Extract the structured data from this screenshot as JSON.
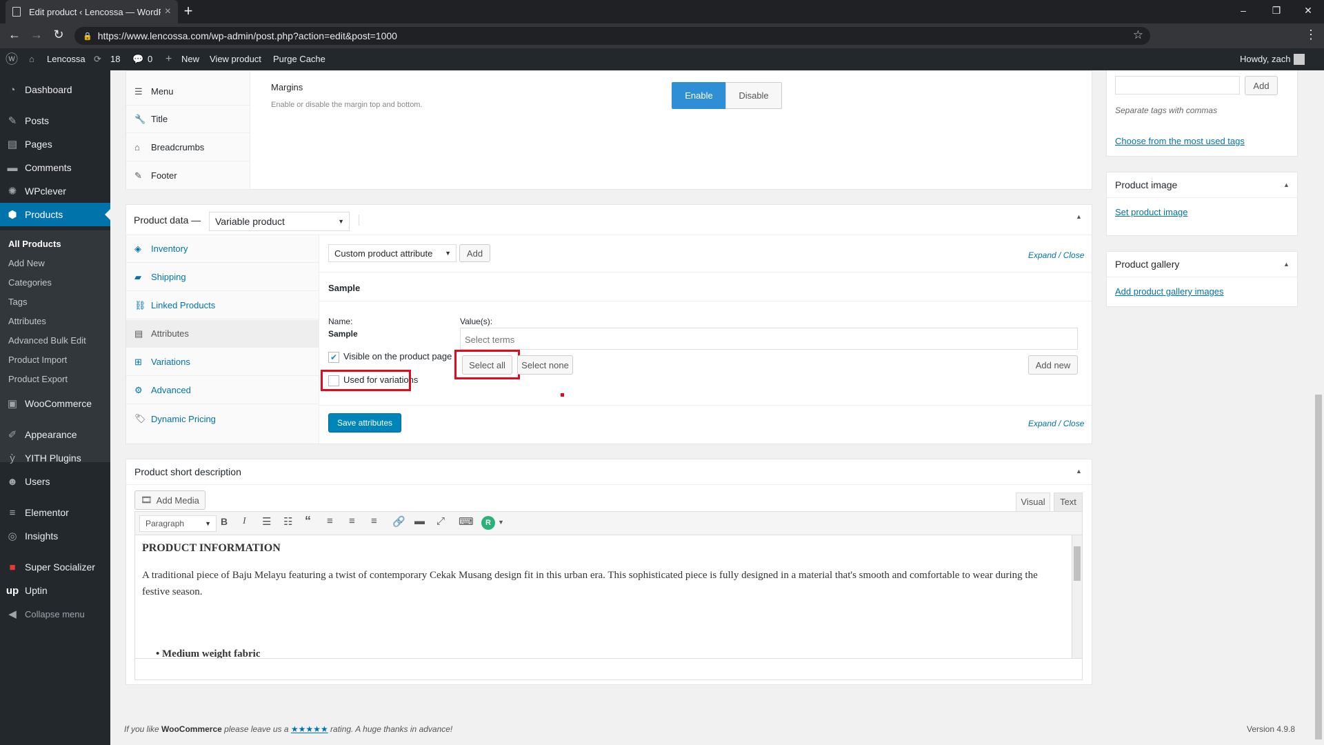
{
  "browser": {
    "tab_title": "Edit product ‹ Lencossa — WordPress",
    "url": "https://www.lencossa.com/wp-admin/post.php?action=edit&post=1000",
    "new_tab_glyph": "+",
    "close_glyph": "×",
    "minimize_glyph": "–",
    "restore_glyph": "❐",
    "window_close_glyph": "✕"
  },
  "adminbar": {
    "site_name": "Lencossa",
    "updates_count": "18",
    "comments_count": "0",
    "new_label": "New",
    "view_label": "View product",
    "purge_label": "Purge Cache",
    "howdy": "Howdy, zach"
  },
  "sidebar": {
    "items": [
      {
        "label": "Dashboard",
        "icon": "dashboard-icon"
      },
      {
        "label": "Posts",
        "icon": "pin-icon"
      },
      {
        "label": "Pages",
        "icon": "pages-icon"
      },
      {
        "label": "Comments",
        "icon": "comment-icon"
      },
      {
        "label": "WPclever",
        "icon": "gear-icon"
      },
      {
        "label": "Products",
        "icon": "box-icon"
      },
      {
        "label": "WooCommerce",
        "icon": "woo-icon"
      },
      {
        "label": "Appearance",
        "icon": "brush-icon"
      },
      {
        "label": "YITH Plugins",
        "icon": "yith-icon"
      },
      {
        "label": "Users",
        "icon": "user-icon"
      },
      {
        "label": "Elementor",
        "icon": "elementor-icon"
      },
      {
        "label": "Insights",
        "icon": "insights-icon"
      },
      {
        "label": "Super Socializer",
        "icon": "share-icon"
      },
      {
        "label": "Uptin",
        "icon": "uptin-icon"
      },
      {
        "label": "Collapse menu",
        "icon": "collapse-icon"
      }
    ],
    "submenu": [
      "All Products",
      "Add New",
      "Categories",
      "Tags",
      "Attributes",
      "Advanced Bulk Edit",
      "Product Import",
      "Product Export"
    ]
  },
  "layout_panel": {
    "tabs": [
      "Menu",
      "Title",
      "Breadcrumbs",
      "Footer"
    ],
    "margins_title": "Margins",
    "margins_desc": "Enable or disable the margin top and bottom.",
    "enable_label": "Enable",
    "disable_label": "Disable"
  },
  "product_data": {
    "label": "Product data —",
    "type_value": "Variable product",
    "tabs": [
      "Inventory",
      "Shipping",
      "Linked Products",
      "Attributes",
      "Variations",
      "Advanced",
      "Dynamic Pricing"
    ],
    "attribute_select": "Custom product attribute",
    "add_label": "Add",
    "expand_close": "Expand / Close",
    "attribute_title": "Sample",
    "name_label": "Name:",
    "name_value": "Sample",
    "values_label": "Value(s):",
    "values_placeholder": "Select terms",
    "visible_label": "Visible on the product page",
    "variations_label": "Used for variations",
    "select_all": "Select all",
    "select_none": "Select none",
    "add_new": "Add new",
    "save_attributes": "Save attributes"
  },
  "short_desc": {
    "title": "Product short description",
    "add_media": "Add Media",
    "tab_visual": "Visual",
    "tab_text": "Text",
    "format_value": "Paragraph",
    "heading": "PRODUCT INFORMATION",
    "paragraph": "A traditional piece of Baju Melayu featuring a twist of contemporary Cekak Musang design fit in this urban era. This sophisticated piece is fully designed in a material that's smooth and comfortable to wear during the festive season.",
    "bullet": "Medium weight fabric"
  },
  "right_column": {
    "tags_add": "Add",
    "tags_hint": "Separate tags with commas",
    "tags_link": "Choose from the most used tags",
    "image_title": "Product image",
    "image_link": "Set product image",
    "gallery_title": "Product gallery",
    "gallery_link": "Add product gallery images"
  },
  "footer": {
    "text_before": "If you like ",
    "brand": "WooCommerce",
    "text_mid": " please leave us a ",
    "stars": "★★★★★",
    "text_after": " rating. A huge thanks in advance!",
    "version": "Version 4.9.8"
  },
  "colors": {
    "accent": "#0073aa",
    "highlight": "#e00b1f",
    "admin_bg": "#23282d"
  }
}
